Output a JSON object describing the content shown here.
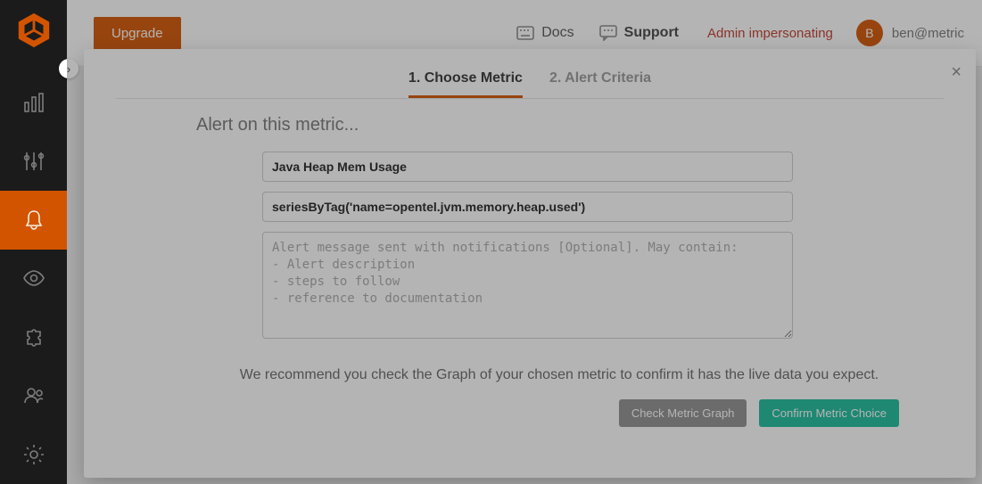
{
  "topbar": {
    "upgrade_label": "Upgrade",
    "docs_label": "Docs",
    "support_label": "Support",
    "impersonating_label": "Admin impersonating",
    "avatar_initial": "B",
    "user_email": "ben@metric"
  },
  "modal": {
    "tabs": {
      "choose_metric": "1. Choose Metric",
      "alert_criteria": "2. Alert Criteria"
    },
    "heading": "Alert on this metric...",
    "metric_name_value": "Java Heap Mem Usage",
    "metric_query_value": "seriesByTag('name=opentel.jvm.memory.heap.used')",
    "message_placeholder": "Alert message sent with notifications [Optional]. May contain:\n- Alert description\n- steps to follow\n- reference to documentation",
    "recommend_text": "We recommend you check the Graph of your chosen metric to confirm it has the live data you expect.",
    "check_graph_label": "Check Metric Graph",
    "confirm_label": "Confirm Metric Choice"
  }
}
